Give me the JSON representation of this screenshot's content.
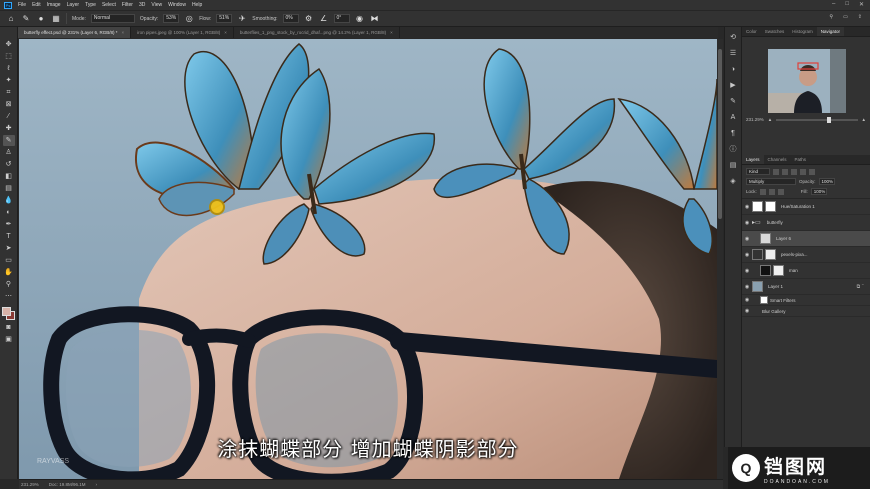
{
  "menubar": {
    "logo": "Ps",
    "items": [
      "File",
      "Edit",
      "Image",
      "Layer",
      "Type",
      "Select",
      "Filter",
      "3D",
      "View",
      "Window",
      "Help"
    ]
  },
  "options": {
    "mode_label": "Mode:",
    "mode_value": "Normal",
    "opacity_label": "Opacity:",
    "opacity_value": "53%",
    "flow_label": "Flow:",
    "flow_value": "51%",
    "smoothing_label": "Smoothing:",
    "smoothing_value": "0%",
    "angle_value": "0°"
  },
  "tabs": [
    {
      "label": "butterfly effect.psd @ 231% (Layer 6, RGB/8) *",
      "close": "×"
    },
    {
      "label": "iron pipes.jpeg @ 100% (Layer 1, RGB/8)",
      "close": "×"
    },
    {
      "label": "butterflies_1_png_stock_by_rocrid_dhaf...png @ 14.2% (Layer 1, RGB/8)",
      "close": "×"
    }
  ],
  "canvas": {
    "subtitle": "涂抹蝴蝶部分  增加蝴蝶阴影部分",
    "watermark": "RAYVASS"
  },
  "statusbar": {
    "zoom": "231.29%",
    "doc": "Doc: 19.8M/96.1M"
  },
  "panels": {
    "nav_tabs": [
      "Color",
      "Swatches",
      "Histogram",
      "Navigator"
    ],
    "nav_zoom": "231.29%",
    "layer_tabs": [
      "Layers",
      "Channels",
      "Paths"
    ],
    "kind_label": "Kind",
    "blend_mode": "Multiply",
    "opacity_label": "Opacity:",
    "opacity_value": "100%",
    "lock_label": "Lock:",
    "fill_label": "Fill:",
    "fill_value": "100%",
    "layers": [
      {
        "name": "Hue/Saturation 1",
        "thumb": "#ffffff",
        "selected": false
      },
      {
        "name": "butterfly",
        "thumb": "#6a6a6a",
        "selected": false
      },
      {
        "name": "Layer 6",
        "thumb": "#d8d8d8",
        "selected": true
      },
      {
        "name": "pexels-pixa...",
        "thumb": "#333333",
        "selected": false
      },
      {
        "name": "man",
        "thumb": "#111111",
        "selected": false
      },
      {
        "name": "Layer 1",
        "thumb": "#8aa0b0",
        "selected": false
      }
    ],
    "smart_filters": "Smart Filters",
    "blur_gallery": "Blur Gallery"
  },
  "logo": {
    "mark": "Q",
    "big": "铛图网",
    "small": "DOANDOAN.COM"
  },
  "colors": {
    "foreground": "#d7b2a8",
    "background": "#8a3b35",
    "accent": "#31a8ff"
  }
}
